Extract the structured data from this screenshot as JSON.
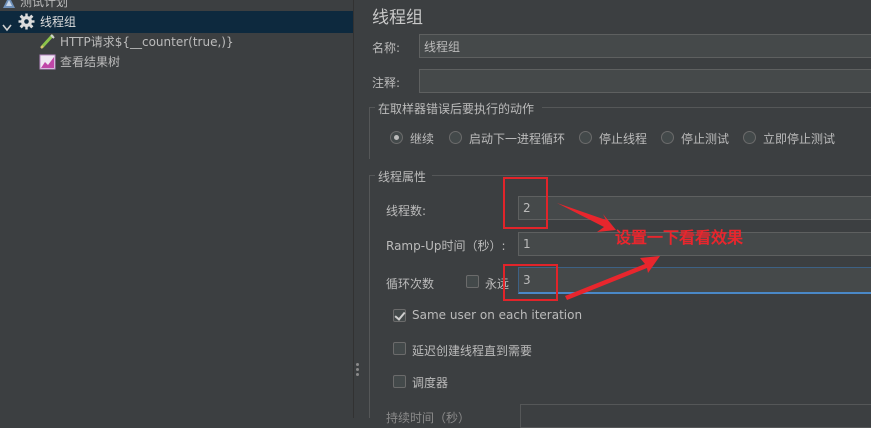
{
  "tree": {
    "root_label": "测试计划",
    "thread_group_label": "线程组",
    "http_label": "HTTP请求${__counter(true,)}",
    "result_tree_label": "查看结果树"
  },
  "panel": {
    "title": "线程组",
    "name_label": "名称:",
    "name_value": "线程组",
    "comment_label": "注释:",
    "comment_value": "",
    "error_action": {
      "legend": "在取样器错误后要执行的动作",
      "options": [
        "继续",
        "启动下一进程循环",
        "停止线程",
        "停止测试",
        "立即停止测试"
      ],
      "selected": "继续"
    },
    "thread_props": {
      "legend": "线程属性",
      "threads_label": "线程数:",
      "threads_value": "2",
      "rampup_label": "Ramp-Up时间（秒）:",
      "rampup_value": "1",
      "loop_label": "循环次数",
      "forever_label": "永远",
      "forever_checked": false,
      "loop_value": "3",
      "same_user_label": "Same user on each iteration",
      "same_user_checked": true,
      "delay_label": "延迟创建线程直到需要",
      "delay_checked": false,
      "scheduler_label": "调度器",
      "scheduler_checked": false,
      "duration_label": "持续时间（秒）"
    }
  },
  "annotation": {
    "text": "设置一下看看效果",
    "color": "#e8262d"
  }
}
